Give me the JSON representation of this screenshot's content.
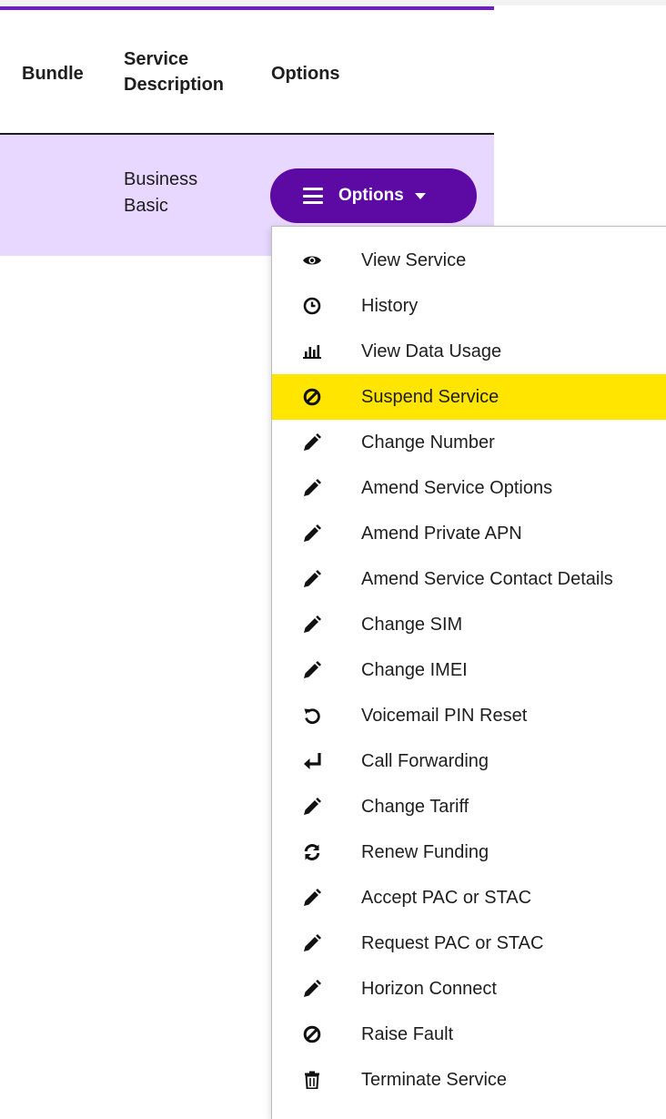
{
  "table": {
    "headers": {
      "bundle": "Bundle",
      "service_description": "Service\nDescription",
      "options": "Options"
    },
    "row": {
      "bundle": "",
      "service_description": "Business\nBasic"
    }
  },
  "options_button": {
    "label": "Options",
    "icon": "hamburger-menu-icon",
    "caret": "caret-down-icon"
  },
  "menu": {
    "highlighted_item": "Suspend Service",
    "items": [
      {
        "label": "View Service",
        "icon": "eye-icon"
      },
      {
        "label": "History",
        "icon": "clock-icon"
      },
      {
        "label": "View Data Usage",
        "icon": "bar-chart-icon"
      },
      {
        "label": "Suspend Service",
        "icon": "ban-icon"
      },
      {
        "label": "Change Number",
        "icon": "pencil-icon"
      },
      {
        "label": "Amend Service Options",
        "icon": "pencil-icon"
      },
      {
        "label": "Amend Private APN",
        "icon": "pencil-icon"
      },
      {
        "label": "Amend Service Contact Details",
        "icon": "pencil-icon"
      },
      {
        "label": "Change SIM",
        "icon": "pencil-icon"
      },
      {
        "label": "Change IMEI",
        "icon": "pencil-icon"
      },
      {
        "label": "Voicemail PIN Reset",
        "icon": "reset-icon"
      },
      {
        "label": "Call Forwarding",
        "icon": "forward-arrow-icon"
      },
      {
        "label": "Change Tariff",
        "icon": "pencil-icon"
      },
      {
        "label": "Renew Funding",
        "icon": "refresh-icon"
      },
      {
        "label": "Accept PAC or STAC",
        "icon": "pencil-icon"
      },
      {
        "label": "Request PAC or STAC",
        "icon": "pencil-icon"
      },
      {
        "label": "Horizon Connect",
        "icon": "pencil-icon"
      },
      {
        "label": "Raise Fault",
        "icon": "ban-icon"
      },
      {
        "label": "Terminate Service",
        "icon": "trash-icon"
      }
    ]
  },
  "colors": {
    "accent_purple": "#5d0aa5",
    "top_border_purple": "#6f1ad1",
    "row_background": "#e8d7ff",
    "highlight_yellow": "#ffe500"
  }
}
